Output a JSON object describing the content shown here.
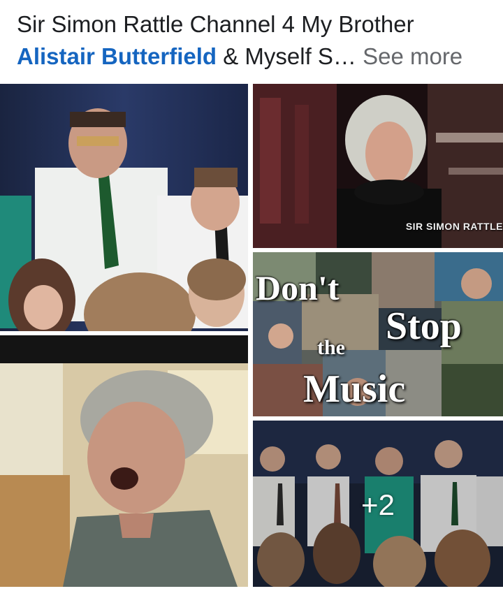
{
  "post": {
    "text_line1": "Sir Simon Rattle Channel 4 My Brother",
    "tag_name": "Alistair Butterfield",
    "text_line2_rest": " & Myself S…",
    "see_more": "See more"
  },
  "gallery": {
    "photo2_caption": "SIR SIMON RATTLE",
    "photo3_title": {
      "word1": "Don't",
      "word2": "Stop",
      "word3": "the",
      "word4": "Music"
    },
    "more_count": "+2"
  },
  "colors": {
    "link": "#1565c0",
    "text": "#1c1e21",
    "secondary": "#65676b"
  }
}
